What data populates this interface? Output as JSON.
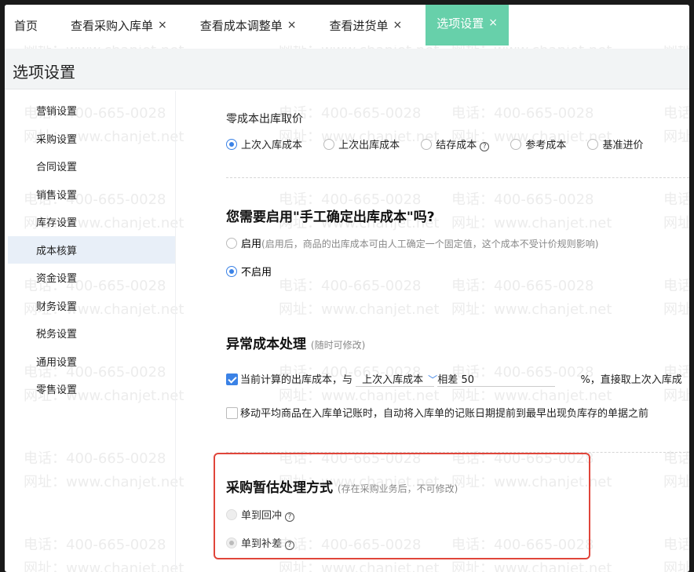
{
  "tabs": [
    {
      "label": "首页",
      "closable": false
    },
    {
      "label": "查看采购入库单",
      "closable": true
    },
    {
      "label": "查看成本调整单",
      "closable": true
    },
    {
      "label": "查看进货单",
      "closable": true
    },
    {
      "label": "选项设置",
      "closable": true,
      "active": true
    }
  ],
  "close_glyph": "×",
  "page_title": "选项设置",
  "sidebar": {
    "items": [
      "营销设置",
      "采购设置",
      "合同设置",
      "销售设置",
      "库存设置",
      "成本核算",
      "资金设置",
      "财务设置",
      "税务设置",
      "通用设置",
      "零售设置"
    ],
    "active": "成本核算"
  },
  "zero_cost": {
    "title": "零成本出库取价",
    "options": [
      "上次入库成本",
      "上次出库成本",
      "结存成本",
      "参考成本",
      "基准进价"
    ],
    "selected": "上次入库成本"
  },
  "manual": {
    "title": "您需要启用\"手工确定出库成本\"吗?",
    "enable_label": "启用",
    "enable_note": "(启用后，商品的出库成本可由人工确定一个固定值，这个成本不受计价规则影响)",
    "disable_label": "不启用",
    "selected": "不启用"
  },
  "abnormal": {
    "title": "异常成本处理",
    "note": "(随时可修改)",
    "row1_prefix": "当前计算的出库成本，与",
    "row1_select": "上次入库成本",
    "row1_diff_label": "相差",
    "row1_diff_value": "50",
    "row1_suffix": "%，直接取上次入库成",
    "row1_checked": true,
    "row2_label": "移动平均商品在入库单记账时，自动将入库单的记账日期提前到最早出现负库存的单据之前",
    "row2_checked": false
  },
  "estimate": {
    "title": "采购暂估处理方式",
    "note": "(存在采购业务后，不可修改)",
    "options": [
      "单到回冲",
      "单到补差"
    ],
    "selected": "单到补差",
    "disabled": true
  },
  "help_glyph": "?",
  "watermark": [
    "电话：400-665-0028",
    "网址：www.chanjet.net"
  ],
  "colors": {
    "accent": "#67d0aa",
    "primary": "#3b82e6",
    "highlight": "#e0453a"
  }
}
